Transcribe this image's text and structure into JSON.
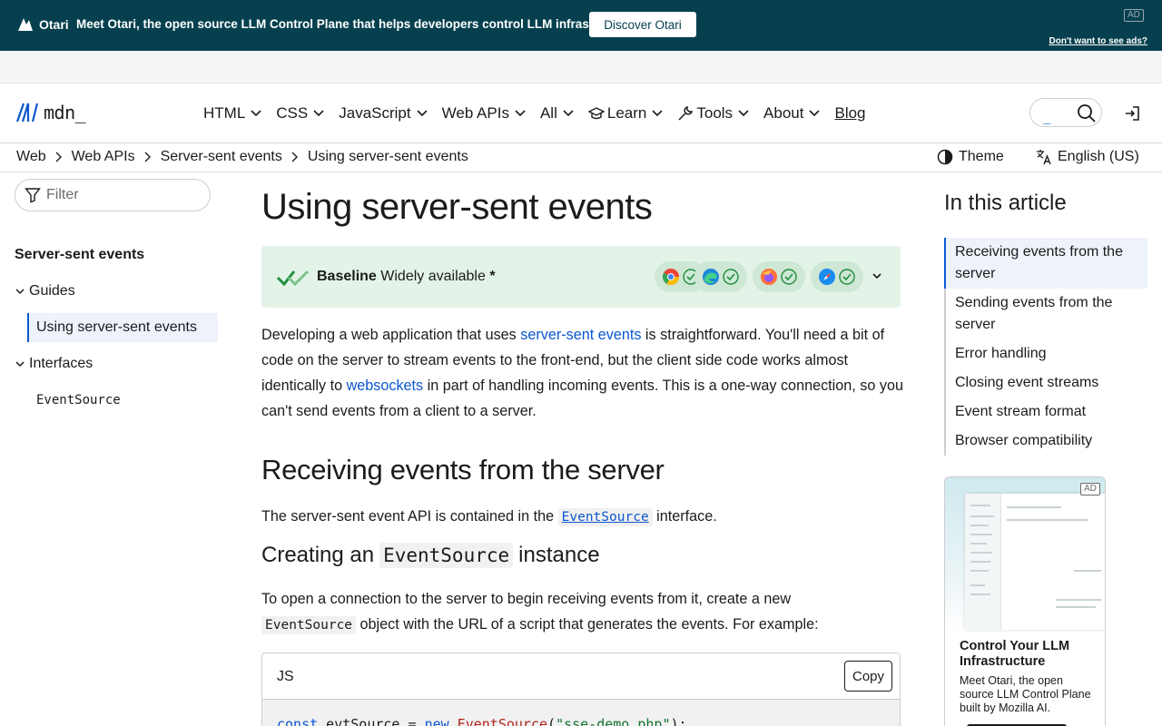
{
  "ad_banner": {
    "brand": "Otari",
    "message": "Meet Otari, the open source LLM Control Plane that helps developers control LLM infrastructure.",
    "cta": "Discover Otari",
    "tag": "AD",
    "optout": "Don't want to see ads?"
  },
  "header": {
    "logo_text": "mdn_",
    "nav": [
      {
        "label": "HTML"
      },
      {
        "label": "CSS"
      },
      {
        "label": "JavaScript"
      },
      {
        "label": "Web APIs"
      },
      {
        "label": "All"
      },
      {
        "label": "Learn",
        "icon": "learn-icon"
      },
      {
        "label": "Tools",
        "icon": "wrench-icon"
      },
      {
        "label": "About"
      }
    ],
    "blog": "Blog",
    "search_caret": "_"
  },
  "breadcrumbs": [
    "Web",
    "Web APIs",
    "Server-sent events",
    "Using server-sent events"
  ],
  "toolbar": {
    "theme": "Theme",
    "language": "English (US)"
  },
  "sidebar": {
    "filter_placeholder": "Filter",
    "title": "Server-sent events",
    "groups": [
      {
        "label": "Guides",
        "items": [
          "Using server-sent events"
        ]
      },
      {
        "label": "Interfaces",
        "items": [
          "EventSource"
        ]
      }
    ]
  },
  "article": {
    "title": "Using server-sent events",
    "baseline": {
      "label": "Baseline",
      "status": "Widely available",
      "asterisk": "*"
    },
    "intro": {
      "t1": "Developing a web application that uses ",
      "link1": "server-sent events",
      "t2": " is straightforward. You'll need a bit of code on the server to stream events to the front-end, but the client side code works almost identically to ",
      "link2": "websockets",
      "t3": " in part of handling incoming events. This is a one-way connection, so you can't send events from a client to a server."
    },
    "h2": "Receiving events from the server",
    "p2": {
      "t1": "The server-sent event API is contained in the ",
      "code": "EventSource",
      "t2": " interface."
    },
    "h3": {
      "t1": "Creating an ",
      "code": "EventSource",
      "t2": " instance"
    },
    "p3": {
      "t1": "To open a connection to the server to begin receiving events from it, create a new ",
      "code": "EventSource",
      "t2": " object with the URL of a script that generates the events. For example:"
    },
    "code_block": {
      "lang": "JS",
      "copy": "Copy",
      "line": {
        "kw1": "const",
        "var": " evtSource = ",
        "kw2": "new",
        "sp": " ",
        "fn": "EventSource",
        "open": "(",
        "str": "\"sse-demo.php\"",
        "close": ");"
      }
    }
  },
  "toc": {
    "title": "In this article",
    "items": [
      "Receiving events from the server",
      "Sending events from the server",
      "Error handling",
      "Closing event streams",
      "Event stream format",
      "Browser compatibility"
    ]
  },
  "side_ad": {
    "tag": "AD",
    "title": "Control Your LLM Infrastructure",
    "body": "Meet Otari, the open source LLM Control Plane built by Mozilla AI."
  },
  "colors": {
    "accent": "#0b57d0",
    "banner_bg": "#06404f",
    "baseline_bg": "#e3f3e7"
  }
}
